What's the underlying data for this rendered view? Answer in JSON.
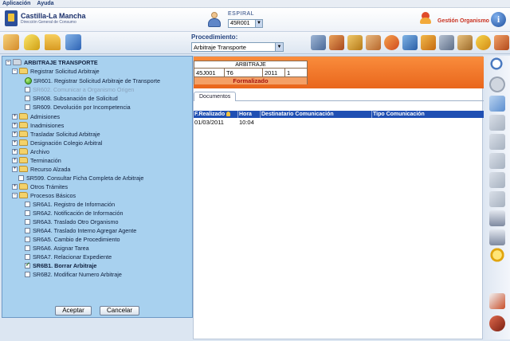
{
  "menu": {
    "items": [
      "Aplicación",
      "Ayuda"
    ]
  },
  "header": {
    "logo_title": "Castilla-La Mancha",
    "logo_subtitle": "Dirección General de Consumo",
    "espiral_label": "ESPIRAL",
    "espiral_value": "45R001",
    "gestion_label": "Gestión Organismo",
    "info_glyph": "i"
  },
  "toolbar": {
    "procedimiento_label": "Procedimiento:",
    "procedimiento_value": "Arbitraje Transporte"
  },
  "tree": {
    "root": "ARBITRAJE TRANSPORTE",
    "group_registrar": "Registrar Solicitud Arbitraje",
    "sr601": "SR601. Registrar Solicitud Arbitraje de Transporte",
    "sr602": "SR602. Comunicar a Organismo Origen",
    "sr608": "SR608. Subsanación de Solicitud",
    "sr609": "SR609. Devolución por Incompetencia",
    "admisiones": "Admisiones",
    "inadmisiones": "Inadmisiones",
    "trasladar": "Trasladar Solicitud Arbitraje",
    "designacion": "Designación Colegio Arbitral",
    "archivo": "Archivo",
    "terminacion": "Terminación",
    "recurso": "Recurso Alzada",
    "sr599": "SR599. Consultar Ficha Completa de Arbitraje",
    "otros": "Otros Trámites",
    "procesos": "Procesos Básicos",
    "sr6a1": "SR6A1. Registro de Información",
    "sr6a2": "SR6A2. Notificación de Información",
    "sr6a3": "SR6A3. Traslado Otro Organismo",
    "sr6a4": "SR6A4. Traslado Interno Agregar Agente",
    "sr6a5": "SR6A5. Cambio de Procedimiento",
    "sr6a6": "SR6A6. Asignar Tarea",
    "sr6a7": "SR6A7. Relacionar Expediente",
    "sr6b1": "SR6B1. Borrar Arbitraje",
    "sr6b2": "SR6B2. Modificar Numero Arbitraje",
    "aceptar": "Aceptar",
    "cancelar": "Cancelar"
  },
  "case": {
    "title": "ARBITRAJE",
    "code": "45J001",
    "type": "T6",
    "year": "2011",
    "number": "1",
    "status": "Formalizado"
  },
  "tabs": {
    "documentos": "Documentos"
  },
  "grid": {
    "headers": [
      "F.Realizado",
      "Hora",
      "Destinatario Comunicación",
      "Tipo Comunicación"
    ],
    "rows": [
      {
        "fecha": "01/03/2011",
        "hora": "10:04",
        "destinatario": "",
        "tipo": ""
      }
    ]
  },
  "colors": {
    "orange": "#f98c3c",
    "grid_header": "#1f4fb3",
    "tree_bg": "#a8d1ef",
    "status_text": "#a7140e"
  }
}
